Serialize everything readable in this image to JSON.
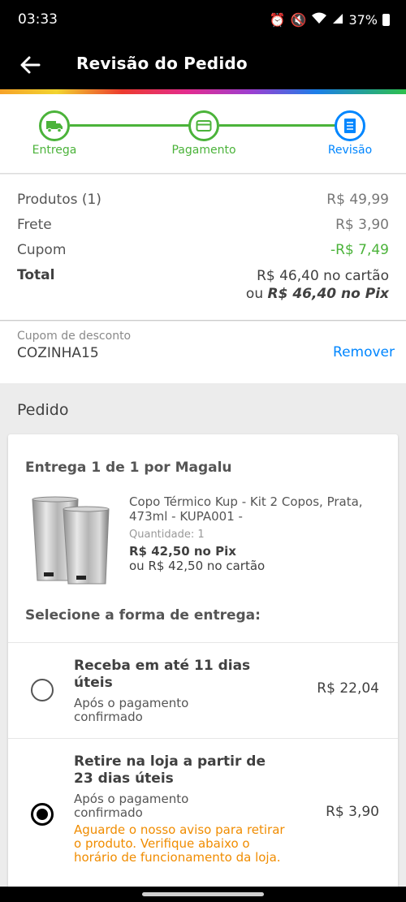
{
  "status_bar": {
    "time": "03:33",
    "battery": "37%"
  },
  "header": {
    "title": "Revisão do Pedido"
  },
  "steps": [
    {
      "label": "Entrega",
      "icon": "truck-icon"
    },
    {
      "label": "Pagamento",
      "icon": "card-icon"
    },
    {
      "label": "Revisão",
      "icon": "document-icon"
    }
  ],
  "summary": {
    "products_label": "Produtos (1)",
    "products_value": "R$ 49,99",
    "shipping_label": "Frete",
    "shipping_value": "R$ 3,90",
    "coupon_label": "Cupom",
    "coupon_value": "-R$ 7,49",
    "total_label": "Total",
    "total_card": "R$ 46,40 no cartão",
    "total_pix_prefix": "ou",
    "total_pix": "R$ 46,40 no Pix"
  },
  "coupon": {
    "label": "Cupom de desconto",
    "code": "COZINHA15",
    "remove": "Remover"
  },
  "order": {
    "section_title": "Pedido",
    "delivery_title": "Entrega 1 de 1 por Magalu",
    "product": {
      "name": "Copo Térmico Kup - Kit 2 Copos, Prata, 473ml - KUPA001 -",
      "quantity": "Quantidade:  1",
      "price_pix": "R$ 42,50 no Pix",
      "price_card": "ou R$ 42,50 no cartão"
    },
    "select_label": "Selecione a forma de entrega:",
    "options": [
      {
        "title": "Receba em até 11 dias úteis",
        "subtitle": "Após o pagamento confirmado",
        "price": "R$ 22,04",
        "selected": false
      },
      {
        "title": "Retire na loja a partir de 23 dias úteis",
        "subtitle": "Após o pagamento confirmado",
        "notice": "Aguarde o nosso aviso para retirar o produto. Verifique abaixo o horário de funcionamento da loja.",
        "price": "R$ 3,90",
        "selected": true
      }
    ]
  },
  "colors": {
    "green": "#4bb33a",
    "blue": "#0086ff",
    "orange": "#f08c00"
  }
}
